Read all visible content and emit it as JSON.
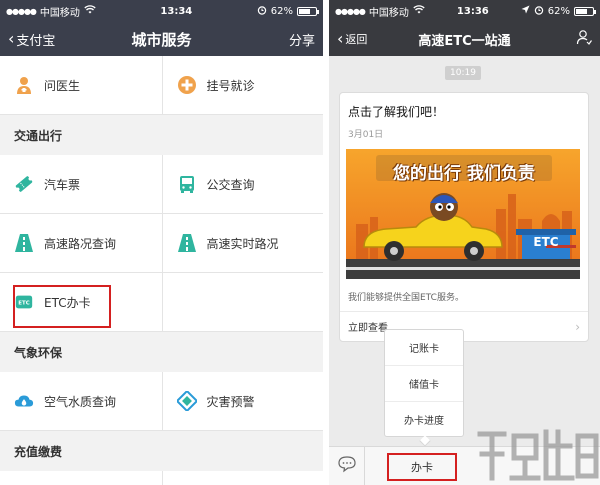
{
  "left_phone": {
    "status": {
      "carrier": "中国移动",
      "time": "13:34",
      "battery": "62%"
    },
    "nav": {
      "back_label": "支付宝",
      "title": "城市服务",
      "share_label": "分享"
    },
    "top_row": [
      {
        "label": "问医生",
        "icon": "doctor-icon"
      },
      {
        "label": "挂号就诊",
        "icon": "plus-circle-icon"
      }
    ],
    "sections": [
      {
        "title": "交通出行",
        "rows": [
          [
            {
              "label": "汽车票",
              "icon": "ticket-icon"
            },
            {
              "label": "公交查询",
              "icon": "bus-icon"
            }
          ],
          [
            {
              "label": "高速路况查询",
              "icon": "highway-icon"
            },
            {
              "label": "高速实时路况",
              "icon": "highway-icon"
            }
          ],
          [
            {
              "label": "ETC办卡",
              "icon": "etc-icon"
            },
            {
              "label": "",
              "icon": ""
            }
          ]
        ]
      },
      {
        "title": "气象环保",
        "rows": [
          [
            {
              "label": "空气水质查询",
              "icon": "cloud-icon"
            },
            {
              "label": "灾害预警",
              "icon": "alert-icon"
            }
          ]
        ]
      },
      {
        "title": "充值缴费",
        "rows": []
      }
    ],
    "colors": {
      "header_bg": "#3b3f4c",
      "icon_green": "#2fb59f",
      "icon_orange": "#f0a24c",
      "highlight_red": "#d42020"
    }
  },
  "right_phone": {
    "status": {
      "carrier": "中国移动",
      "time": "13:36",
      "battery": "62%"
    },
    "nav": {
      "back_label": "返回",
      "title": "高速ETC一站通"
    },
    "time_pill": "10:19",
    "card": {
      "title": "点击了解我们吧！",
      "date": "3月01日",
      "banner_text": "您的出行 我们负责",
      "banner_sign": "ETC",
      "description": "我们能够提供全国ETC服务。",
      "link_label": "立即查看"
    },
    "popup_menu": [
      "记账卡",
      "储值卡",
      "办卡进度"
    ],
    "bottom_tab": "办卡",
    "colors": {
      "header_bg": "#393a3f",
      "banner_orange": "#f08a1c",
      "highlight_red": "#d42020"
    }
  }
}
